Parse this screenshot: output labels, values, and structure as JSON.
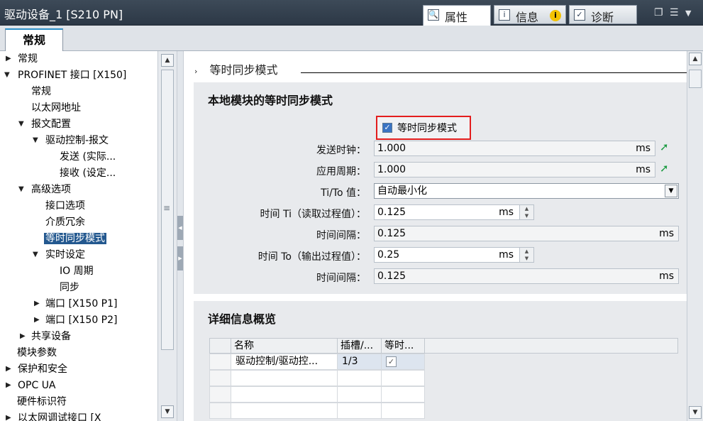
{
  "window": {
    "title": "驱动设备_1 [S210 PN]"
  },
  "header_tabs": [
    {
      "label": "属性",
      "icon": "properties-icon"
    },
    {
      "label": "信息",
      "icon": "info-icon",
      "badge": "i"
    },
    {
      "label": "诊断",
      "icon": "diagnostics-icon"
    }
  ],
  "sub_tab": {
    "label": "常规"
  },
  "tree": {
    "items": [
      {
        "label": "常规"
      },
      {
        "label": "PROFINET 接口 [X150]"
      },
      {
        "label": "常规"
      },
      {
        "label": "以太网地址"
      },
      {
        "label": "报文配置"
      },
      {
        "label": "驱动控制-报文"
      },
      {
        "label": "发送 (实际..."
      },
      {
        "label": "接收 (设定..."
      },
      {
        "label": "高级选项"
      },
      {
        "label": "接口选项"
      },
      {
        "label": "介质冗余"
      },
      {
        "label": "等时同步模式"
      },
      {
        "label": "实时设定"
      },
      {
        "label": "IO 周期"
      },
      {
        "label": "同步"
      },
      {
        "label": "端口 [X150 P1]"
      },
      {
        "label": "端口 [X150 P2]"
      },
      {
        "label": "共享设备"
      },
      {
        "label": "模块参数"
      },
      {
        "label": "保护和安全"
      },
      {
        "label": "OPC UA"
      },
      {
        "label": "硬件标识符"
      },
      {
        "label": "以太网调试接口 [X"
      }
    ]
  },
  "main": {
    "section_header": "等时同步模式",
    "panel1": {
      "title": "本地模块的等时同步模式",
      "checkbox_label": "等时同步模式",
      "checkbox_checked": true,
      "send_clock": {
        "label": "发送时钟：",
        "value": "1.000",
        "unit": "ms"
      },
      "app_cycle": {
        "label": "应用周期：",
        "value": "1.000",
        "unit": "ms"
      },
      "ti_to": {
        "label": "Ti/To 值：",
        "value": "自动最小化"
      },
      "time_ti": {
        "label": "时间 Ti（读取过程值）：",
        "value": "0.125",
        "unit": "ms"
      },
      "interval1": {
        "label": "时间间隔：",
        "value": "0.125",
        "unit": "ms"
      },
      "time_to": {
        "label": "时间 To（输出过程值）：",
        "value": "0.25",
        "unit": "ms"
      },
      "interval2": {
        "label": "时间间隔：",
        "value": "0.125",
        "unit": "ms"
      }
    },
    "panel2": {
      "title": "详细信息概览",
      "columns": [
        "名称",
        "插槽/...",
        "等时..."
      ],
      "rows": [
        {
          "name": "驱动控制/驱动控...",
          "slot": "1/3",
          "iso": true
        }
      ]
    }
  }
}
